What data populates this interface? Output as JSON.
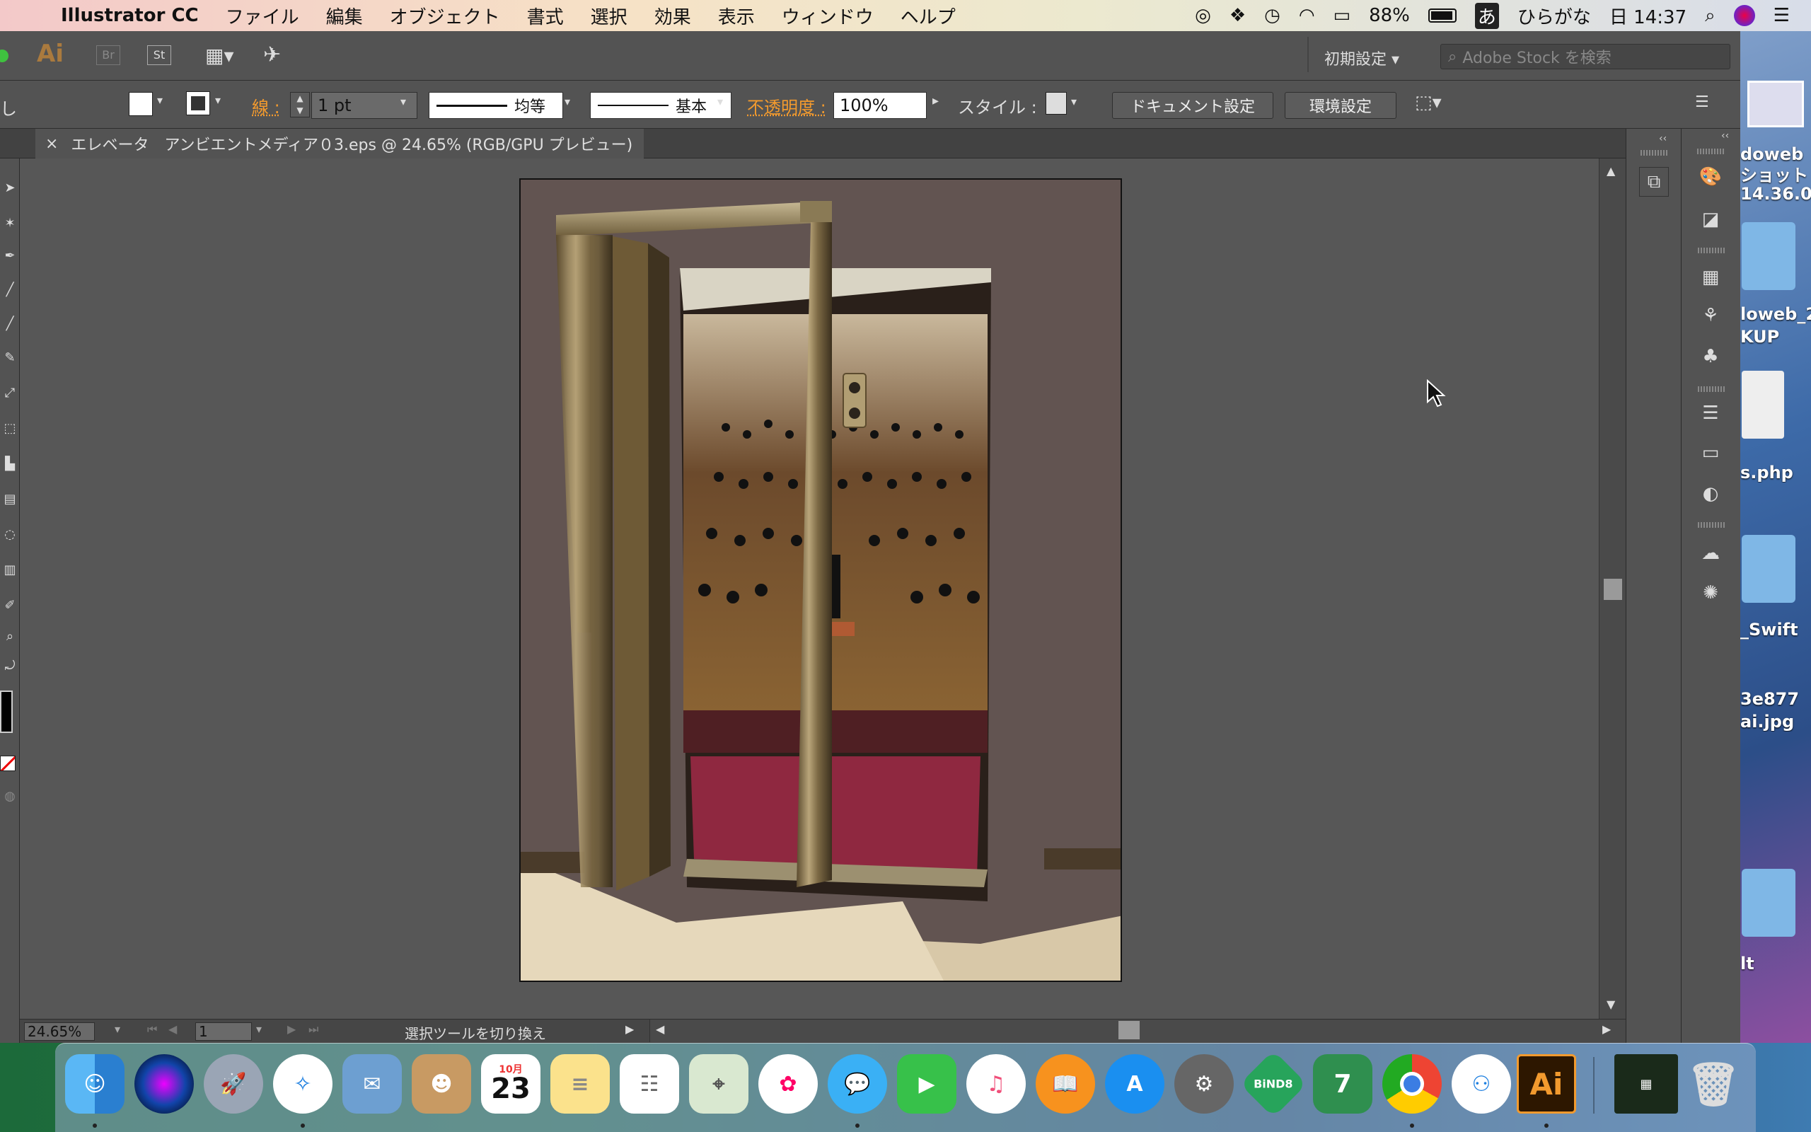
{
  "menubar": {
    "app_name": "Illustrator CC",
    "items": [
      "ファイル",
      "編集",
      "オブジェクト",
      "書式",
      "選択",
      "効果",
      "表示",
      "ウィンドウ",
      "ヘルプ"
    ],
    "battery": "88%",
    "input_mode": "ひらがな",
    "input_icon": "あ",
    "clock": "日 14:37"
  },
  "appbar": {
    "logo": "Ai",
    "bridge": "Br",
    "stock": "St",
    "workspace": "初期設定",
    "search_placeholder": "Adobe Stock を検索"
  },
  "control": {
    "left_label": "し",
    "stroke_label": "線 :",
    "stroke_weight": "1 pt",
    "profile_label": "均等",
    "brush_label": "基本",
    "opacity_label": "不透明度 :",
    "opacity_value": "100%",
    "style_label": "スタイル :",
    "doc_setup": "ドキュメント設定",
    "prefs": "環境設定"
  },
  "document": {
    "tab_title": "エレベータ　アンビエントメディア０3.eps @ 24.65% (RGB/GPU プレビュー)",
    "close": "×"
  },
  "status": {
    "zoom": "24.65%",
    "page": "1",
    "message": "選択ツールを切り換え"
  },
  "desktop_labels": [
    "doweb",
    "ショット",
    "14.36.0",
    "loweb_2",
    "KUP",
    "s.php",
    "_Swift",
    "3e877",
    "ai.jpg",
    "lt"
  ],
  "dock": {
    "calendar_month": "10月",
    "calendar_day": "23",
    "bind8": "BiND8",
    "bind7": "7",
    "ai": "Ai"
  },
  "colors": {
    "accent_orange": "#f29a2e",
    "ui_panel": "#535353",
    "canvas": "#575757"
  }
}
